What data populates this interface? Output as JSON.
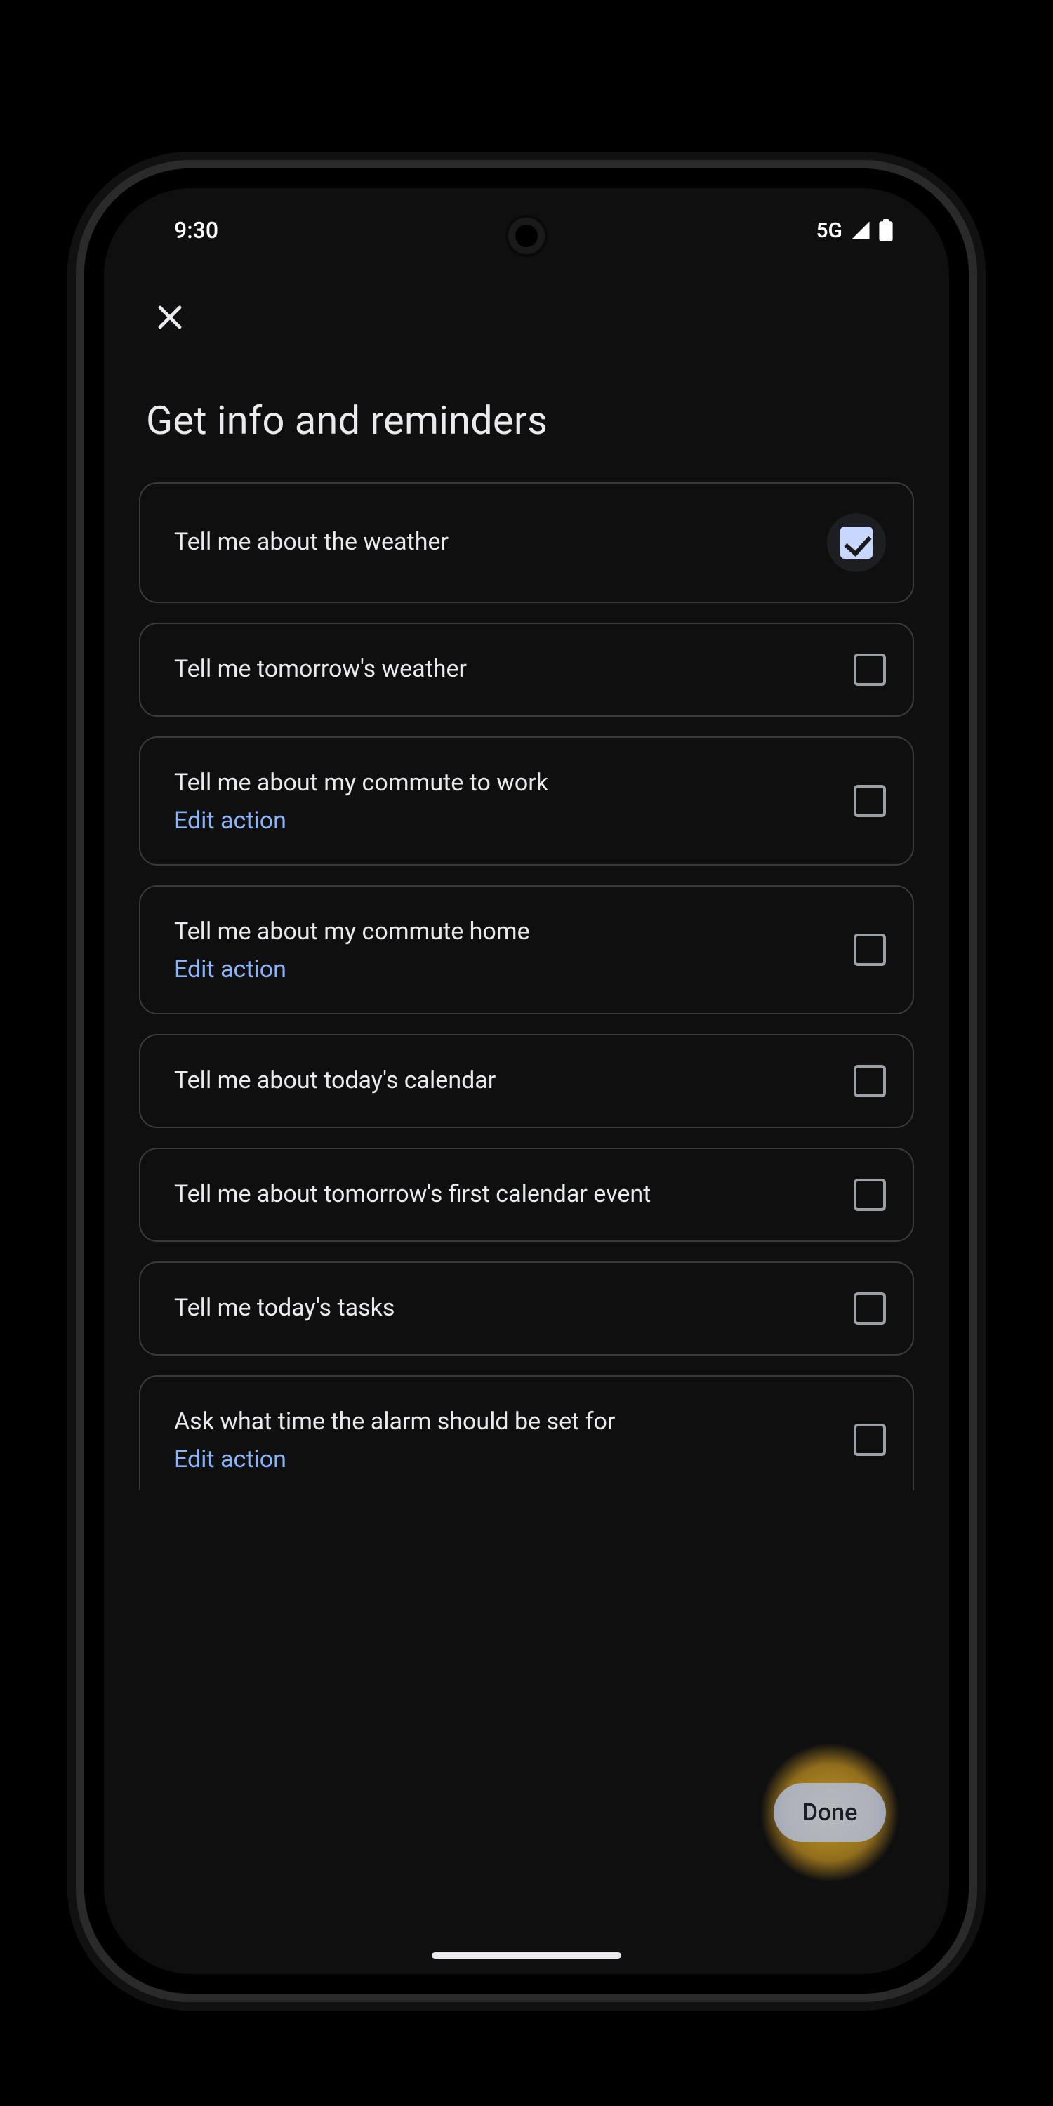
{
  "statusbar": {
    "time": "9:30",
    "network_label": "5G"
  },
  "header": {
    "close_icon": "close",
    "title": "Get info and reminders"
  },
  "edit_action_label": "Edit action",
  "items": [
    {
      "label": "Tell me about the weather",
      "checked": true,
      "has_edit": false
    },
    {
      "label": "Tell me tomorrow's weather",
      "checked": false,
      "has_edit": false
    },
    {
      "label": "Tell me about my commute to work",
      "checked": false,
      "has_edit": true
    },
    {
      "label": "Tell me about my commute home",
      "checked": false,
      "has_edit": true
    },
    {
      "label": "Tell me about today's calendar",
      "checked": false,
      "has_edit": false
    },
    {
      "label": "Tell me about tomorrow's first calendar event",
      "checked": false,
      "has_edit": false
    },
    {
      "label": "Tell me today's tasks",
      "checked": false,
      "has_edit": false
    },
    {
      "label": "Ask what time the alarm should be set for",
      "checked": false,
      "has_edit": true
    }
  ],
  "footer": {
    "done_label": "Done"
  }
}
